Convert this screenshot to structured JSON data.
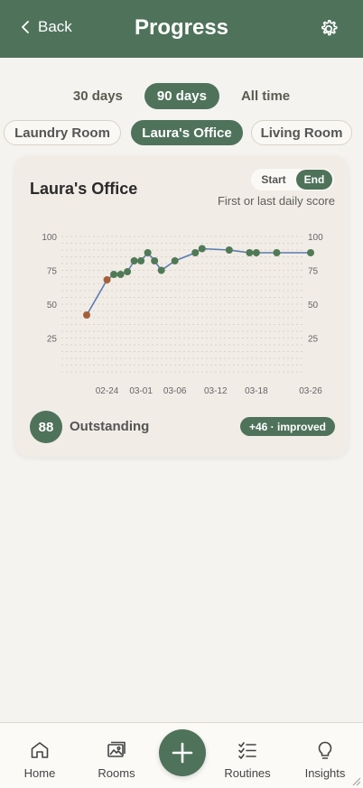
{
  "header": {
    "back_label": "Back",
    "title": "Progress",
    "settings_icon": "gear-icon"
  },
  "ranges": [
    {
      "label": "30 days",
      "active": false
    },
    {
      "label": "90 days",
      "active": true
    },
    {
      "label": "All time",
      "active": false
    }
  ],
  "rooms": [
    {
      "label": "Laundry Room",
      "active": false
    },
    {
      "label": "Laura's Office",
      "active": true
    },
    {
      "label": "Living Room",
      "active": false
    }
  ],
  "card": {
    "title": "Laura's Office",
    "toggle": {
      "start_label": "Start",
      "end_label": "End",
      "selected": "End"
    },
    "subtitle": "First or last daily score",
    "score": "88",
    "score_label": "Outstanding",
    "change_badge": "+46 · improved"
  },
  "chart_data": {
    "type": "line",
    "title": "",
    "xlabel": "",
    "ylabel": "",
    "ylim": [
      0,
      100
    ],
    "y_ticks": [
      "25",
      "50",
      "75",
      "100"
    ],
    "x_ticks": [
      {
        "label": "02-24",
        "x": 0
      },
      {
        "label": "03-01",
        "x": 5
      },
      {
        "label": "03-06",
        "x": 10
      },
      {
        "label": "03-12",
        "x": 16
      },
      {
        "label": "03-18",
        "x": 22
      },
      {
        "label": "03-26",
        "x": 30
      }
    ],
    "grid": true,
    "series": [
      {
        "line_color": "#5b7bb0",
        "points": [
          {
            "x": -3,
            "y": 42,
            "color": "#a5603a"
          },
          {
            "x": 0,
            "y": 68,
            "color": "#a5603a"
          },
          {
            "x": 1,
            "y": 72,
            "color": "#4f7a55"
          },
          {
            "x": 2,
            "y": 72,
            "color": "#4f7a55"
          },
          {
            "x": 3,
            "y": 74,
            "color": "#4f7a55"
          },
          {
            "x": 4,
            "y": 82,
            "color": "#4f7a55"
          },
          {
            "x": 5,
            "y": 82,
            "color": "#4f7a55"
          },
          {
            "x": 6,
            "y": 88,
            "color": "#4f7a55"
          },
          {
            "x": 7,
            "y": 82,
            "color": "#4f7a55"
          },
          {
            "x": 8,
            "y": 75,
            "color": "#4f7a55"
          },
          {
            "x": 10,
            "y": 82,
            "color": "#4f7a55"
          },
          {
            "x": 13,
            "y": 88,
            "color": "#4f7a55"
          },
          {
            "x": 14,
            "y": 91,
            "color": "#4f7a55"
          },
          {
            "x": 18,
            "y": 90,
            "color": "#4f7a55"
          },
          {
            "x": 21,
            "y": 88,
            "color": "#4f7a55"
          },
          {
            "x": 22,
            "y": 88,
            "color": "#4f7a55"
          },
          {
            "x": 25,
            "y": 88,
            "color": "#4f7a55"
          },
          {
            "x": 30,
            "y": 88,
            "color": "#4f7a55"
          }
        ]
      }
    ]
  },
  "nav": [
    {
      "label": "Home",
      "icon": "home-icon"
    },
    {
      "label": "Rooms",
      "icon": "rooms-icon"
    },
    {
      "label": "Routines",
      "icon": "checklist-icon"
    },
    {
      "label": "Insights",
      "icon": "lightbulb-icon"
    }
  ],
  "colors": {
    "primary": "#4f725b",
    "background": "#f5f3ef",
    "card": "#f1ece6"
  }
}
